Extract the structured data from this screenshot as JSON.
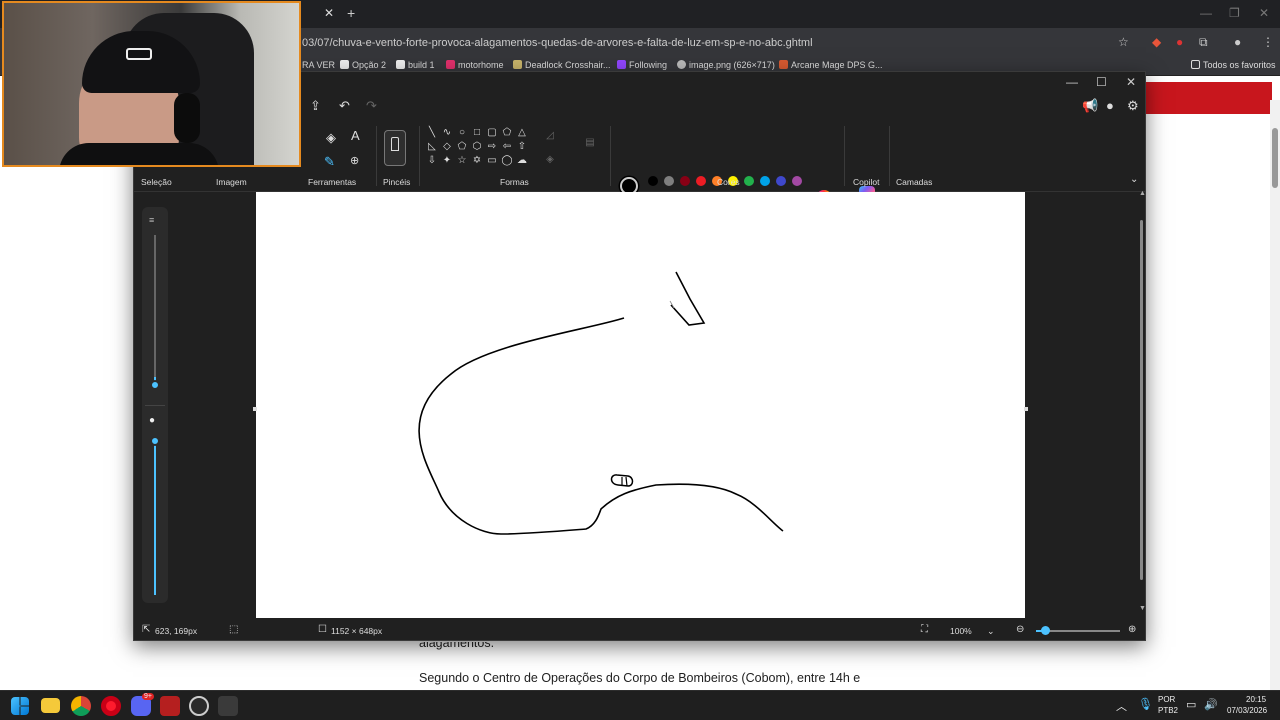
{
  "browser": {
    "url": "03/07/chuva-e-vento-forte-provoca-alagamentos-quedas-de-arvores-e-falta-de-luz-em-sp-e-no-abc.ghtml",
    "bookmarks": [
      {
        "label": "RA VER",
        "color": "#888888"
      },
      {
        "label": "Opção 2",
        "color": "#eeeeee"
      },
      {
        "label": "build 1",
        "color": "#eeeeee"
      },
      {
        "label": "motorhome",
        "color": "#e1306c"
      },
      {
        "label": "Deadlock Crosshair...",
        "color": "#c9b56b"
      },
      {
        "label": "Following",
        "color": "#9146ff"
      },
      {
        "label": "image.png (626×717)",
        "color": "#bbbbbb"
      },
      {
        "label": "Arcane Mage DPS G...",
        "color": "#d65a31"
      }
    ],
    "all_bookmarks": "Todos os favoritos"
  },
  "article": {
    "partial_line": "alagamentos.",
    "line": "Segundo o Centro de Operações do Corpo de Bombeiros (Cobom), entre 14h e"
  },
  "paint": {
    "groups": {
      "selection": "Seleção",
      "image": "Imagem",
      "tools": "Ferramentas",
      "brushes": "Pincéis",
      "shapes": "Formas",
      "colors": "Cores",
      "copilot": "Copilot",
      "layers": "Camadas"
    },
    "palette": {
      "row1": [
        "#000000",
        "#7f7f7f",
        "#880015",
        "#ed1c24",
        "#ff7f27",
        "#fff200",
        "#22b14c",
        "#00a2e8",
        "#3f48cc",
        "#a349a4"
      ],
      "row2": [
        "#ffffff",
        "#c3c3c3",
        "#b97a57",
        "#ffaec9",
        "#ffc90e",
        "#efe4b0",
        "#b5e61d",
        "#99d9ea",
        "#7092be",
        "#c8bfe7"
      ]
    },
    "status": {
      "cursor": "623, 169px",
      "canvas_size": "1152 × 648px",
      "zoom": "100%"
    }
  },
  "taskbar": {
    "lang_top": "POR",
    "lang_bottom": "PTB2",
    "time": "20:15",
    "date": "07/03/2026",
    "badge": "9+"
  }
}
